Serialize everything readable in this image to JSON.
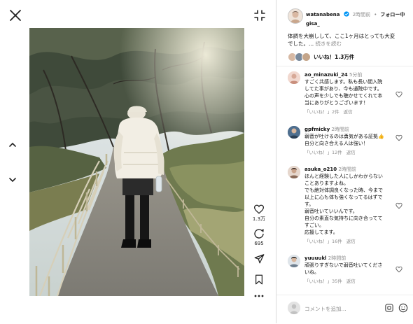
{
  "post": {
    "username_line1": "watanabena",
    "username_line2": "gisa_",
    "time": "2時間前",
    "follow_label": "フォロー中",
    "caption_line1": "体調を大崩しして、ここ1ヶ月はとっても大変",
    "caption_line2_prefix": "でした。... ",
    "caption_more": "続きを読む",
    "likes_label": "いいね！1.3万件"
  },
  "actions": {
    "like_count": "1.3万",
    "comment_count": "695"
  },
  "comments": [
    {
      "user": "ao_minazuki_24",
      "time": "5分前",
      "text": "すごく共感します。私も長い間入院\nしてた事があり、今も通院中です。\n心の声を少しでも聴かせてくれて本\n当にありがとうございます！",
      "likes": "「いいね！」2件",
      "reply": "返信"
    },
    {
      "user": "gpfmicky",
      "time": "2時間前",
      "text": "弱音が吐けるのは勇気がある証拠👍\n自分と向き合える人は強い！",
      "likes": "「いいね！」12件",
      "reply": "返信"
    },
    {
      "user": "asuka_o210",
      "time": "2時間前",
      "text": "ほんと経験した人にしかわからない\nことありますよね。\nでも絶対体調良くなった時、今まで\n以上に心も体も強くなってるはずで\nす。\n弱音吐いていいんです。\n自分の素直な気持ちに向き合ってて\nすごい。\n応援してます。",
      "likes": "「いいね！」16件",
      "reply": "返信"
    },
    {
      "user": "yuuuukl",
      "time": "2時間前",
      "text": "頑張りすぎないで弱音吐いてくださ\nいね。",
      "likes": "「いいね！」35件",
      "reply": "返信"
    }
  ],
  "composer": {
    "placeholder": "コメントを追加...",
    "gif_icon": "gif-icon",
    "emoji_icon": "smiley-icon"
  },
  "colors": {
    "accent_blue": "#0095f6",
    "verified": "#0095f6",
    "secondary_text": "#8e8e8e",
    "border": "#dbdbdb"
  }
}
